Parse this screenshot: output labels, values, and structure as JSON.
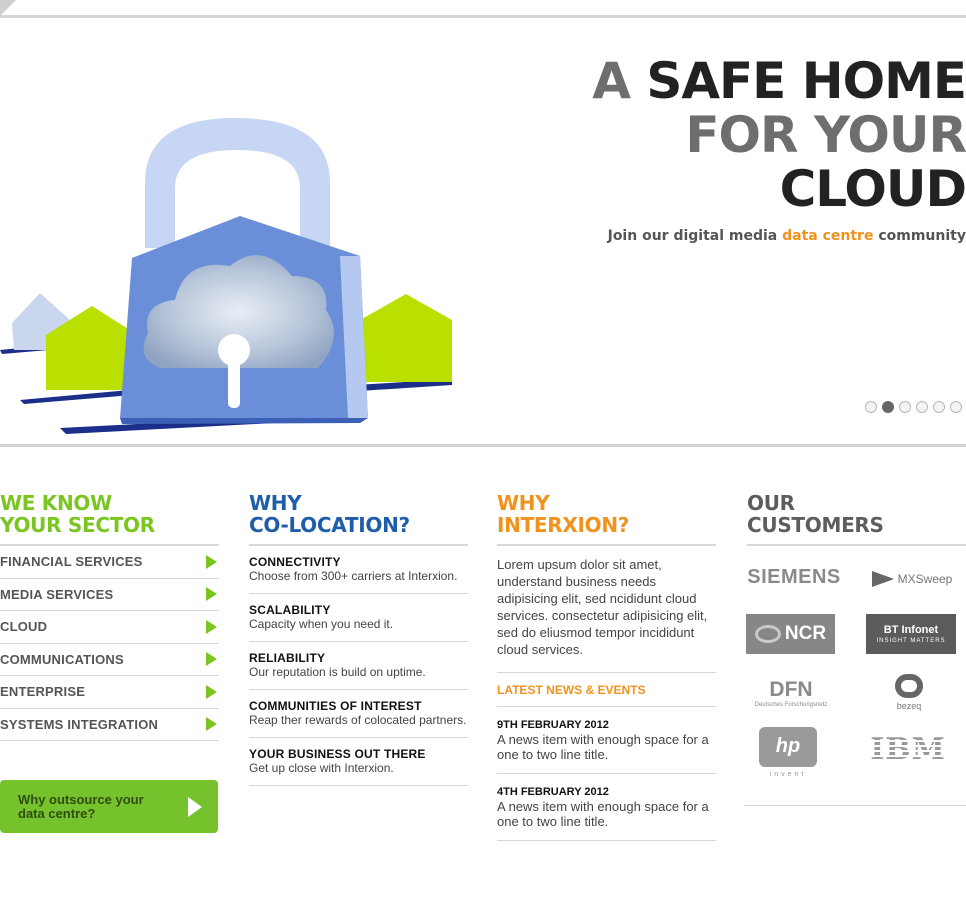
{
  "hero": {
    "headline_a": "A",
    "headline_1": "SAFE HOME",
    "headline_2": "FOR YOUR",
    "headline_3": "CLOUD",
    "tagline_pre": "Join our digital media",
    "tagline_accent": "data centre",
    "tagline_post": "community",
    "slide_count": 6,
    "active_slide": 2
  },
  "sectors": {
    "title_1": "WE KNOW",
    "title_2": "YOUR SECTOR",
    "items": [
      {
        "label": "FINANCIAL SERVICES"
      },
      {
        "label": "MEDIA SERVICES"
      },
      {
        "label": "CLOUD"
      },
      {
        "label": "COMMUNICATIONS"
      },
      {
        "label": "ENTERPRISE"
      },
      {
        "label": "SYSTEMS INTEGRATION"
      }
    ],
    "cta_label": "Why outsource your data centre?"
  },
  "colocation": {
    "title_1": "WHY",
    "title_2": "CO-LOCATION?",
    "features": [
      {
        "title": "CONNECTIVITY",
        "text": "Choose from 300+ carriers at Interxion."
      },
      {
        "title": "SCALABILITY",
        "text": "Capacity when you need it."
      },
      {
        "title": "RELIABILITY",
        "text": "Our reputation is build on uptime."
      },
      {
        "title": "COMMUNITIES OF INTEREST",
        "text": "Reap ther rewards of colocated partners."
      },
      {
        "title": "YOUR BUSINESS OUT THERE",
        "text": "Get up close with Interxion."
      }
    ]
  },
  "interxion": {
    "title_1": "WHY",
    "title_2": "INTERXION?",
    "intro": "Lorem upsum dolor sit amet, understand business needs adipisicing elit, sed ncididunt cloud services. consectetur adipisicing elit, sed do eliusmod tempor incididunt cloud services.",
    "news_heading": "LATEST NEWS & EVENTS",
    "news": [
      {
        "date": "9TH FEBRUARY 2012",
        "text": "A news item with enough space for a one to two line title."
      },
      {
        "date": "4TH FEBRUARY 2012",
        "text": "A news item with enough space for a one to two line title."
      }
    ]
  },
  "customers": {
    "title_1": "OUR",
    "title_2": "CUSTOMERS",
    "logos": {
      "siemens": "SIEMENS",
      "mxsweep": "MXSweep",
      "ncr": "NCR",
      "bt": "BT Infonet",
      "bt_sub": "INSIGHT MATTERS",
      "dfn": "DFN",
      "dfn_sub": "Deutsches Forschungsnetz",
      "bezeq": "bezeq",
      "hp": "hp",
      "hp_sub": "invent",
      "ibm": "IBM"
    }
  },
  "colors": {
    "green": "#7ac520",
    "blue": "#1e5ea8",
    "orange": "#f0921c",
    "grey": "#5d5d5d"
  }
}
